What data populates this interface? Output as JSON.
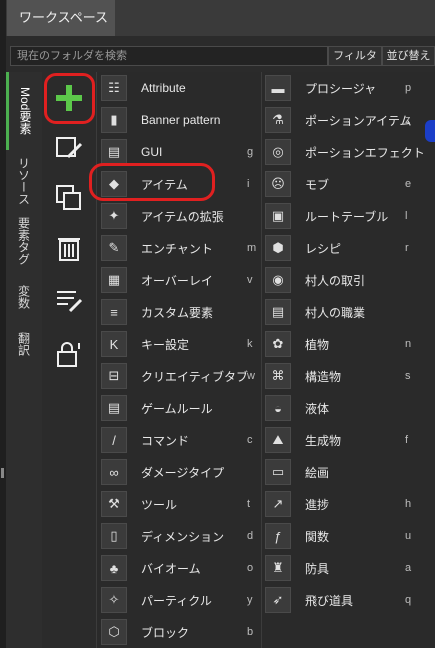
{
  "tab": {
    "label": "ワークスペース"
  },
  "search": {
    "placeholder": "現在のフォルダを検索",
    "filter_label": "フィルタ",
    "sort_label": "並び替え"
  },
  "vertical_tabs": [
    "Mod要素",
    "リソース",
    "要素タグ",
    "変数",
    "翻訳"
  ],
  "tools": [
    {
      "icon": "add-icon"
    },
    {
      "icon": "edit-icon"
    },
    {
      "icon": "duplicate-icon"
    },
    {
      "icon": "delete-icon"
    },
    {
      "icon": "list-edit-icon"
    },
    {
      "icon": "lock-icon"
    }
  ],
  "menu": {
    "left": [
      {
        "icon": "attribute-icon",
        "glyph": "☷",
        "label": "Attribute",
        "key": ""
      },
      {
        "icon": "banner-icon",
        "glyph": "▮",
        "label": "Banner pattern",
        "key": ""
      },
      {
        "icon": "gui-icon",
        "glyph": "▤",
        "label": "GUI",
        "key": "g"
      },
      {
        "icon": "diamond-icon",
        "glyph": "◆",
        "label": "アイテム",
        "key": "i"
      },
      {
        "icon": "item-extension-icon",
        "glyph": "✦",
        "label": "アイテムの拡張",
        "key": ""
      },
      {
        "icon": "enchant-icon",
        "glyph": "✎",
        "label": "エンチャント",
        "key": "m"
      },
      {
        "icon": "overlay-icon",
        "glyph": "▦",
        "label": "オーバーレイ",
        "key": "v"
      },
      {
        "icon": "custom-element-icon",
        "glyph": "≡",
        "label": "カスタム要素",
        "key": ""
      },
      {
        "icon": "keybind-icon",
        "glyph": "K",
        "label": "キー設定",
        "key": "k"
      },
      {
        "icon": "tab-icon",
        "glyph": "⊟",
        "label": "クリエイティブタブ",
        "key": "w"
      },
      {
        "icon": "gamerule-icon",
        "glyph": "▤",
        "label": "ゲームルール",
        "key": ""
      },
      {
        "icon": "command-icon",
        "glyph": "/",
        "label": "コマンド",
        "key": "c"
      },
      {
        "icon": "damage-type-icon",
        "glyph": "∞",
        "label": "ダメージタイプ",
        "key": ""
      },
      {
        "icon": "tool-icon",
        "glyph": "⚒",
        "label": "ツール",
        "key": "t"
      },
      {
        "icon": "dimension-icon",
        "glyph": "▯",
        "label": "ディメンション",
        "key": "d"
      },
      {
        "icon": "biome-icon",
        "glyph": "♣",
        "label": "バイオーム",
        "key": "o"
      },
      {
        "icon": "particle-icon",
        "glyph": "✧",
        "label": "パーティクル",
        "key": "y"
      },
      {
        "icon": "block-icon",
        "glyph": "⬡",
        "label": "ブロック",
        "key": "b"
      }
    ],
    "right": [
      {
        "icon": "folder-icon",
        "glyph": "▬",
        "label": "プロシージャ",
        "key": "p"
      },
      {
        "icon": "potion-icon",
        "glyph": "⚗",
        "label": "ポーションアイテム",
        "key": "z"
      },
      {
        "icon": "potion-effect-icon",
        "glyph": "◎",
        "label": "ポーションエフェクト",
        "key": ""
      },
      {
        "icon": "mob-icon",
        "glyph": "☹",
        "label": "モブ",
        "key": "e"
      },
      {
        "icon": "loot-table-icon",
        "glyph": "▣",
        "label": "ルートテーブル",
        "key": "l"
      },
      {
        "icon": "recipe-icon",
        "glyph": "⬢",
        "label": "レシピ",
        "key": "r"
      },
      {
        "icon": "villager-trade-icon",
        "glyph": "◉",
        "label": "村人の取引",
        "key": ""
      },
      {
        "icon": "villager-profession-icon",
        "glyph": "▤",
        "label": "村人の職業",
        "key": ""
      },
      {
        "icon": "plant-icon",
        "glyph": "✿",
        "label": "植物",
        "key": "n"
      },
      {
        "icon": "structure-icon",
        "glyph": "⌘",
        "label": "構造物",
        "key": "s"
      },
      {
        "icon": "fluid-icon",
        "glyph": "◒",
        "label": "液体",
        "key": ""
      },
      {
        "icon": "generation-icon",
        "glyph": "⛰",
        "label": "生成物",
        "key": "f"
      },
      {
        "icon": "painting-icon",
        "glyph": "▭",
        "label": "絵画",
        "key": ""
      },
      {
        "icon": "advancement-icon",
        "glyph": "↗",
        "label": "進捗",
        "key": "h"
      },
      {
        "icon": "function-icon",
        "glyph": "ƒ",
        "label": "関数",
        "key": "u"
      },
      {
        "icon": "armor-icon",
        "glyph": "♜",
        "label": "防具",
        "key": "a"
      },
      {
        "icon": "projectile-icon",
        "glyph": "➶",
        "label": "飛び道具",
        "key": "q"
      }
    ]
  }
}
